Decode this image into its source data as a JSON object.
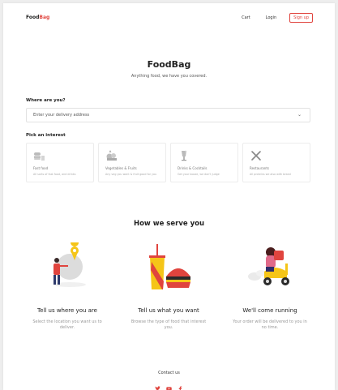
{
  "header": {
    "logo_food": "Food",
    "logo_bag": "Bag",
    "nav": {
      "cart": "Cart",
      "login": "Login",
      "signup": "Sign up"
    }
  },
  "hero": {
    "title": "FoodBag",
    "subtitle": "Anything food, we have you covered."
  },
  "location": {
    "label": "Where are you?",
    "placeholder": "Enter your delivery address",
    "chevron_icon": "chevron-down-icon"
  },
  "interest": {
    "label": "Pick an interest",
    "cards": [
      {
        "icon": "fast-food-icon",
        "title": "Fast food",
        "desc": "All sorts of fast food, and drinks"
      },
      {
        "icon": "vegetables-fruits-icon",
        "title": "Vegetables & Fruits",
        "desc": "Any veg you want & fruit good for you"
      },
      {
        "icon": "drinks-cocktails-icon",
        "title": "Drinks & Cocktails",
        "desc": "Get your booze, we don't judge"
      },
      {
        "icon": "restaurants-icon",
        "title": "Restaurants",
        "desc": "All proteins we also with bread"
      }
    ]
  },
  "serve": {
    "title": "How we serve you",
    "cols": [
      {
        "icon": "location-person-illustration",
        "title": "Tell us where you are",
        "desc": "Select the location you want us to deliver."
      },
      {
        "icon": "food-illustration",
        "title": "Tell us what you want",
        "desc": "Browse the type of food that interest you."
      },
      {
        "icon": "delivery-scooter-illustration",
        "title": "We'll come running",
        "desc": "Your order will be delivered to you in no time."
      }
    ]
  },
  "footer": {
    "contact": "Contact us",
    "socials": [
      "twitter-icon",
      "youtube-icon",
      "facebook-icon"
    ]
  },
  "colors": {
    "accent": "#e0443e",
    "scooter": "#f5c518"
  }
}
